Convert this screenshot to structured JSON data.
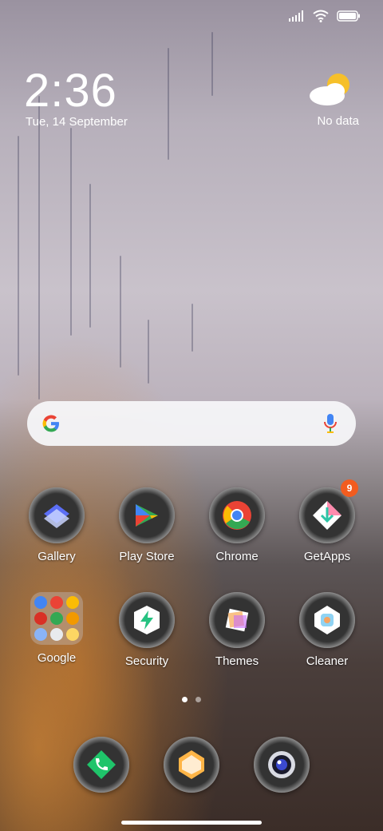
{
  "status_bar": {
    "signal_icon": "signal-icon",
    "wifi_icon": "wifi-icon",
    "battery_icon": "battery-icon"
  },
  "clock": {
    "time": "2:36",
    "date": "Tue, 14 September"
  },
  "weather": {
    "icon": "partly-cloudy-icon",
    "text": "No data"
  },
  "search": {
    "logo": "google-g-icon",
    "mic": "mic-icon"
  },
  "apps": [
    {
      "label": "Gallery"
    },
    {
      "label": "Play Store"
    },
    {
      "label": "Chrome"
    },
    {
      "label": "GetApps",
      "badge": "9"
    },
    {
      "label": "Google"
    },
    {
      "label": "Security"
    },
    {
      "label": "Themes"
    },
    {
      "label": "Cleaner"
    }
  ],
  "dock": [
    {
      "icon": "phone-icon"
    },
    {
      "icon": "messages-icon"
    },
    {
      "icon": "camera-icon"
    }
  ],
  "pager": {
    "pages": 2,
    "current": 1
  },
  "colors": {
    "badge": "#f25c1f",
    "search_bg": "#f5f5f8"
  }
}
